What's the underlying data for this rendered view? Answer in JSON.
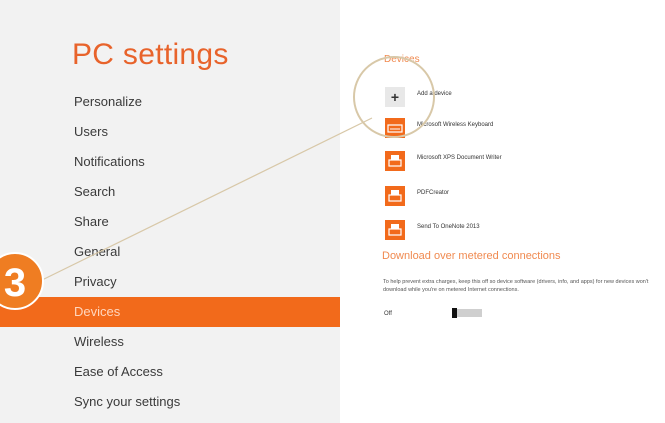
{
  "app": {
    "title": "PC settings"
  },
  "nav": {
    "items": [
      {
        "label": "Personalize"
      },
      {
        "label": "Users"
      },
      {
        "label": "Notifications"
      },
      {
        "label": "Search"
      },
      {
        "label": "Share"
      },
      {
        "label": "General"
      },
      {
        "label": "Privacy"
      },
      {
        "label": "Devices",
        "selected": true
      },
      {
        "label": "Wireless"
      },
      {
        "label": "Ease of Access"
      },
      {
        "label": "Sync your settings"
      }
    ]
  },
  "devices": {
    "title": "Devices",
    "add_label": "Add a device",
    "add_icon": "plus-icon",
    "items": [
      {
        "label": "Microsoft Wireless Keyboard",
        "icon": "keyboard-icon"
      },
      {
        "label": "Microsoft XPS Document Writer",
        "icon": "printer-icon"
      },
      {
        "label": "PDFCreator",
        "icon": "printer-icon"
      },
      {
        "label": "Send To OneNote 2013",
        "icon": "printer-icon"
      }
    ]
  },
  "metered": {
    "title": "Download over metered connections",
    "description": "To help prevent extra charges, keep this off so device software (drivers, info, and apps) for new devices won't download while you're on metered Internet connections.",
    "toggle_state": "Off",
    "toggle_on": false
  },
  "callout": {
    "step_number": "3"
  },
  "colors": {
    "accent": "#f26a1b",
    "badge": "#ef7d22",
    "sidebar_bg": "#f2f2f2"
  }
}
